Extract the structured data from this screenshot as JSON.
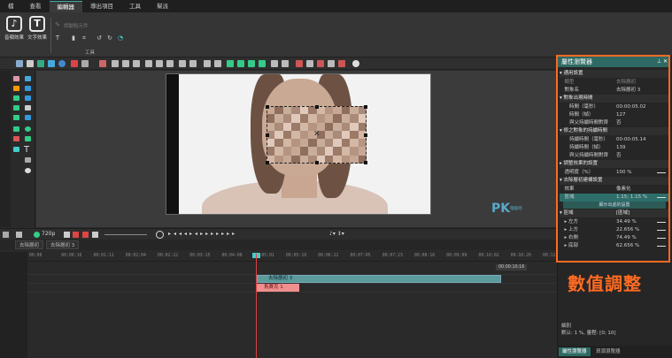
{
  "menu": {
    "tabs": [
      "檔",
      "查看",
      "編輯器",
      "導出項目",
      "工具",
      "幫派"
    ],
    "active_index": 2
  },
  "ribbon": {
    "buttons": [
      {
        "label": "音頻效果",
        "icon": "audio-effects-icon"
      },
      {
        "label": "文字效果",
        "icon": "text-effects-icon"
      }
    ],
    "disabled_item": "調動點元件",
    "tools_label": "工具"
  },
  "preview": {
    "watermark_brand": "PK",
    "watermark_small": "電腦吧"
  },
  "playback": {
    "zoom": "720p"
  },
  "scene_tabs": [
    "去除層初",
    "去除層初 3"
  ],
  "timeline": {
    "ticks": [
      "00:00",
      "00:00:16",
      "00:01:11",
      "00:02:04",
      "00:02:22",
      "00:03:15",
      "00:04:08",
      "00:05:01",
      "00:05:19",
      "00:06:12",
      "00:07:05",
      "00:07:23",
      "00:08:16",
      "00:09:09",
      "00:10:02",
      "00:10:20",
      "00:11:13"
    ],
    "end_time": "00:00:10:16",
    "clips": {
      "mosaic": "去除層初 3",
      "marker": "馬賽克 1"
    }
  },
  "panel": {
    "title": "屬性瀏覽器",
    "rows": [
      {
        "type": "sec",
        "k": "▾ 通用設置",
        "v": ""
      },
      {
        "type": "row",
        "k": "　類型",
        "v": "去除層初",
        "dim": true
      },
      {
        "type": "row",
        "k": "　對象名",
        "v": "去除層初 3"
      },
      {
        "type": "sec",
        "k": "▾ 對象出現時間",
        "v": ""
      },
      {
        "type": "row",
        "k": "　　時間（毫秒）",
        "v": "00:00:05.02"
      },
      {
        "type": "row",
        "k": "　　時間（幀）",
        "v": "127"
      },
      {
        "type": "row",
        "k": "　　與父持續時間對齊",
        "v": "否"
      },
      {
        "type": "sec",
        "k": "▾ 修之對象的持續時間",
        "v": ""
      },
      {
        "type": "row",
        "k": "　　持續時間（毫秒）",
        "v": "00:00:05.14"
      },
      {
        "type": "row",
        "k": "　　持續時間（幀）",
        "v": "139"
      },
      {
        "type": "row",
        "k": "　　與父持續時間對齊",
        "v": "否"
      },
      {
        "type": "sec",
        "k": "▸ 調整效果的設置",
        "v": ""
      },
      {
        "type": "row",
        "k": "　透明度（%）",
        "v": "100 %",
        "bar": true
      },
      {
        "type": "sec",
        "k": "▾ 去除層初建構設置",
        "v": ""
      },
      {
        "type": "row",
        "k": "　效果",
        "v": "像素化"
      },
      {
        "type": "sel",
        "k": "　區域",
        "v": "1.15; 1.15 %",
        "bar": true
      },
      {
        "type": "label",
        "k": "顯示出處的設置",
        "v": ""
      },
      {
        "type": "sec",
        "k": "▾ 區域",
        "v": "[區域]"
      },
      {
        "type": "row",
        "k": "　▸ 左方",
        "v": "34.49 %",
        "bar": true
      },
      {
        "type": "row",
        "k": "　▸ 上方",
        "v": "22.656 %",
        "bar": true
      },
      {
        "type": "row",
        "k": "　▸ 右側",
        "v": "74.49 %",
        "bar": true
      },
      {
        "type": "row",
        "k": "　▸ 底部",
        "v": "62.656 %",
        "bar": true
      }
    ],
    "annotation": "數值調整",
    "description_title": "細別",
    "description_text": "默认: 1 %, 量程: [0; 10]",
    "tabs": [
      "屬性瀏覽器",
      "資源瀏覽器"
    ]
  },
  "colors": {
    "accent": "#2e6a63",
    "highlight": "#ff6a21",
    "clip": "#5c9b9b",
    "marker": "#f08f8f"
  }
}
